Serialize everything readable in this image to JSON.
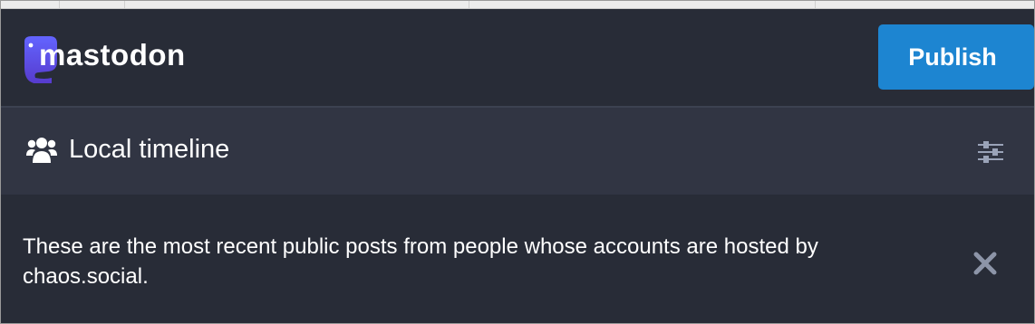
{
  "header": {
    "logo_text": "mastodon",
    "publish_label": "Publish"
  },
  "column": {
    "title": "Local timeline",
    "icon": "users-icon",
    "settings_icon": "sliders-icon"
  },
  "banner": {
    "text": "These are the most recent public posts from people whose accounts are hosted by chaos.social.",
    "dismiss_icon": "close-icon"
  },
  "colors": {
    "background": "#282c37",
    "column_header": "#313543",
    "accent": "#1d85d1",
    "logo_purple": "#6364ff"
  }
}
